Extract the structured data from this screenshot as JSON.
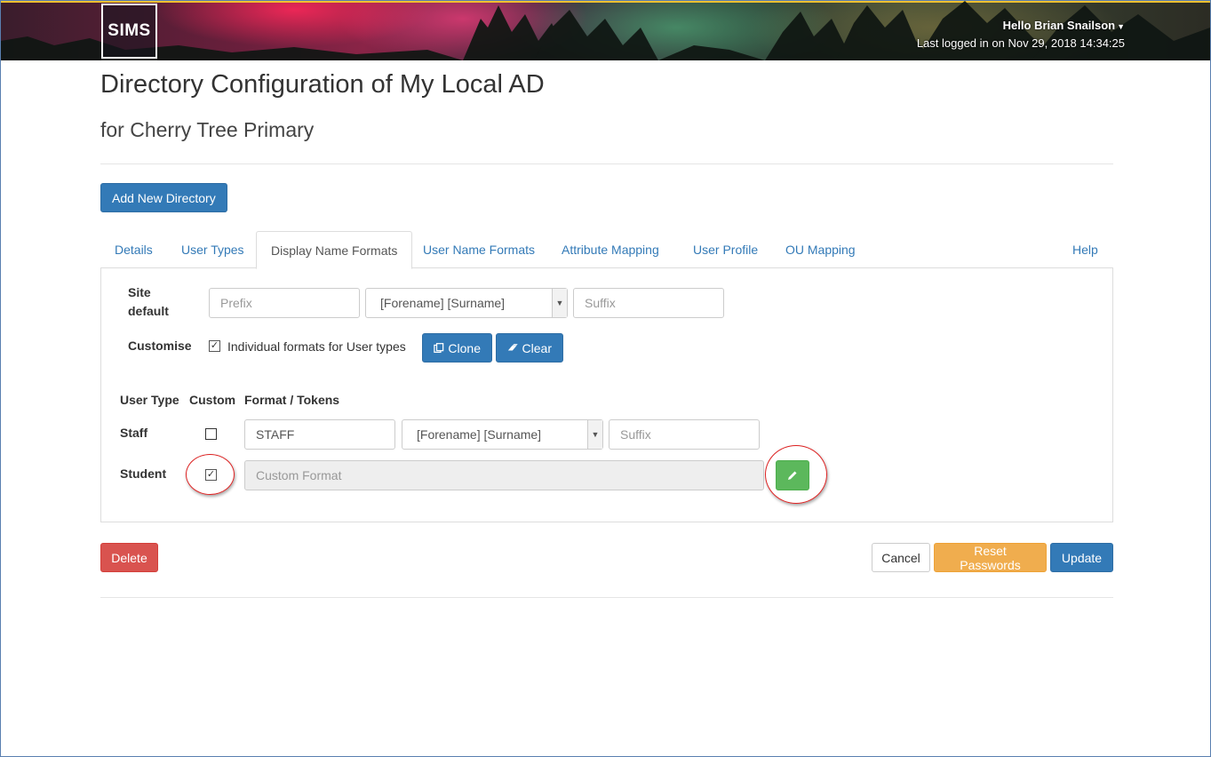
{
  "header": {
    "logo": "SIMS",
    "greeting": "Hello Brian Snailson",
    "last_login": "Last logged in on Nov 29, 2018 14:34:25"
  },
  "page": {
    "title": "Directory Configuration of My Local AD",
    "subtitle": "for Cherry Tree Primary",
    "add_directory_label": "Add New Directory"
  },
  "tabs": [
    {
      "label": "Details"
    },
    {
      "label": "User Types"
    },
    {
      "label": "Display Name Formats",
      "active": true
    },
    {
      "label": "User Name Formats"
    },
    {
      "label": "Attribute Mapping"
    },
    {
      "label": "User Profile"
    },
    {
      "label": "OU Mapping"
    }
  ],
  "help_label": "Help",
  "site_default": {
    "label": "Site default",
    "prefix_placeholder": "Prefix",
    "format_value": "[Forename] [Surname]",
    "suffix_placeholder": "Suffix"
  },
  "customise": {
    "label": "Customise",
    "checkbox_checked": true,
    "checkbox_label": "Individual formats for User types",
    "clone_label": "Clone",
    "clear_label": "Clear"
  },
  "user_types_table": {
    "headers": [
      "User Type",
      "Custom",
      "Format / Tokens"
    ],
    "rows": [
      {
        "type": "Staff",
        "custom": false,
        "prefix_value": "STAFF",
        "format_value": "[Forename] [Surname]",
        "suffix_placeholder": "Suffix"
      },
      {
        "type": "Student",
        "custom": true,
        "custom_format_placeholder": "Custom Format"
      }
    ]
  },
  "footer": {
    "delete_label": "Delete",
    "cancel_label": "Cancel",
    "reset_label": "Reset Passwords",
    "update_label": "Update"
  }
}
